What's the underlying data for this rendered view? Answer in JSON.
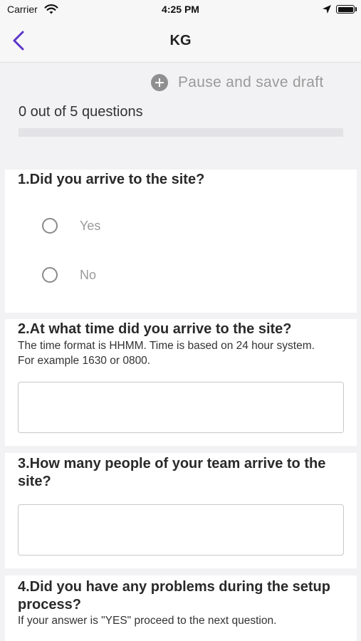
{
  "status_bar": {
    "carrier": "Carrier",
    "time": "4:25 PM",
    "icons": [
      "wifi-icon",
      "location-arrow-icon",
      "battery-icon"
    ]
  },
  "nav": {
    "title": "KG",
    "back_icon": "chevron-left-icon",
    "accent_color": "#5b35c9"
  },
  "header": {
    "pause_label": "Pause and save draft",
    "pause_icon": "plus-circle-icon",
    "progress_text": "0 out of 5 questions",
    "progress_fraction": 0
  },
  "questions": [
    {
      "title": "1.Did you arrive to the site?",
      "options": [
        "Yes",
        "No"
      ]
    },
    {
      "title": "2.At what time did you arrive to the site?",
      "help": "The time format is HHMM. Time is based on 24 hour system. For example 1630 or 0800.",
      "value": ""
    },
    {
      "title": "3.How many people of your team arrive to the site?",
      "value": ""
    },
    {
      "title": "4.Did you have any problems during the setup process?",
      "help": "If your answer is \"YES\" proceed to the next question."
    }
  ]
}
